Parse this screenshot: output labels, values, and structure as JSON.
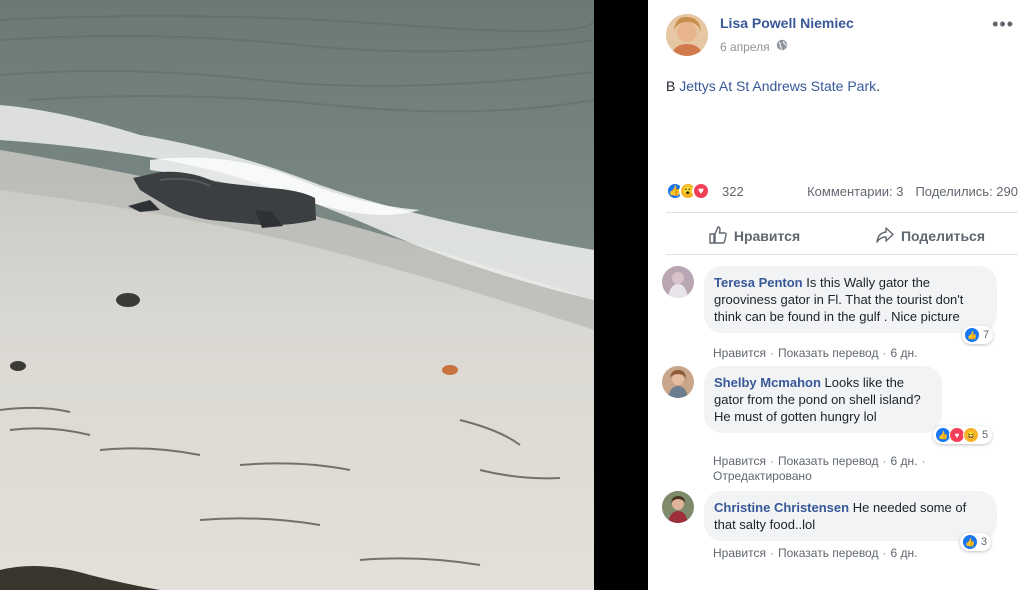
{
  "post": {
    "author": "Lisa Powell Niemiec",
    "date": "6 апреля",
    "privacy_icon": "globe-icon",
    "location_prefix": "В",
    "location_name": "Jettys At St Andrews State Park",
    "location_suffix": ".",
    "reaction_count": "322",
    "comments_label": "Комментарии: 3",
    "shares_label": "Поделились: 290",
    "like_action": "Нравится",
    "share_action": "Поделиться"
  },
  "comments": [
    {
      "name": "Teresa Penton",
      "text": "Is this Wally gator the grooviness gator in Fl. That the tourist don't think can be found in the gulf . Nice picture",
      "like": "Нравится",
      "translate": "Показать перевод",
      "time": "6 дн.",
      "reactions": "7"
    },
    {
      "name": "Shelby Mcmahon",
      "text": "Looks like the gator from the pond on shell island? He must of gotten hungry lol",
      "like": "Нравится",
      "translate": "Показать перевод",
      "time": "6 дн.",
      "edited": "Отредактировано",
      "reactions": "5"
    },
    {
      "name": "Christine Christensen",
      "text": "He needed some of that salty food..lol",
      "like": "Нравится",
      "translate": "Показать перевод",
      "time": "6 дн.",
      "reactions": "3"
    }
  ],
  "colors": {
    "link": "#385898",
    "like_blue": "#1877f2",
    "love_red": "#f33e58",
    "wow_yellow": "#f7b125"
  }
}
